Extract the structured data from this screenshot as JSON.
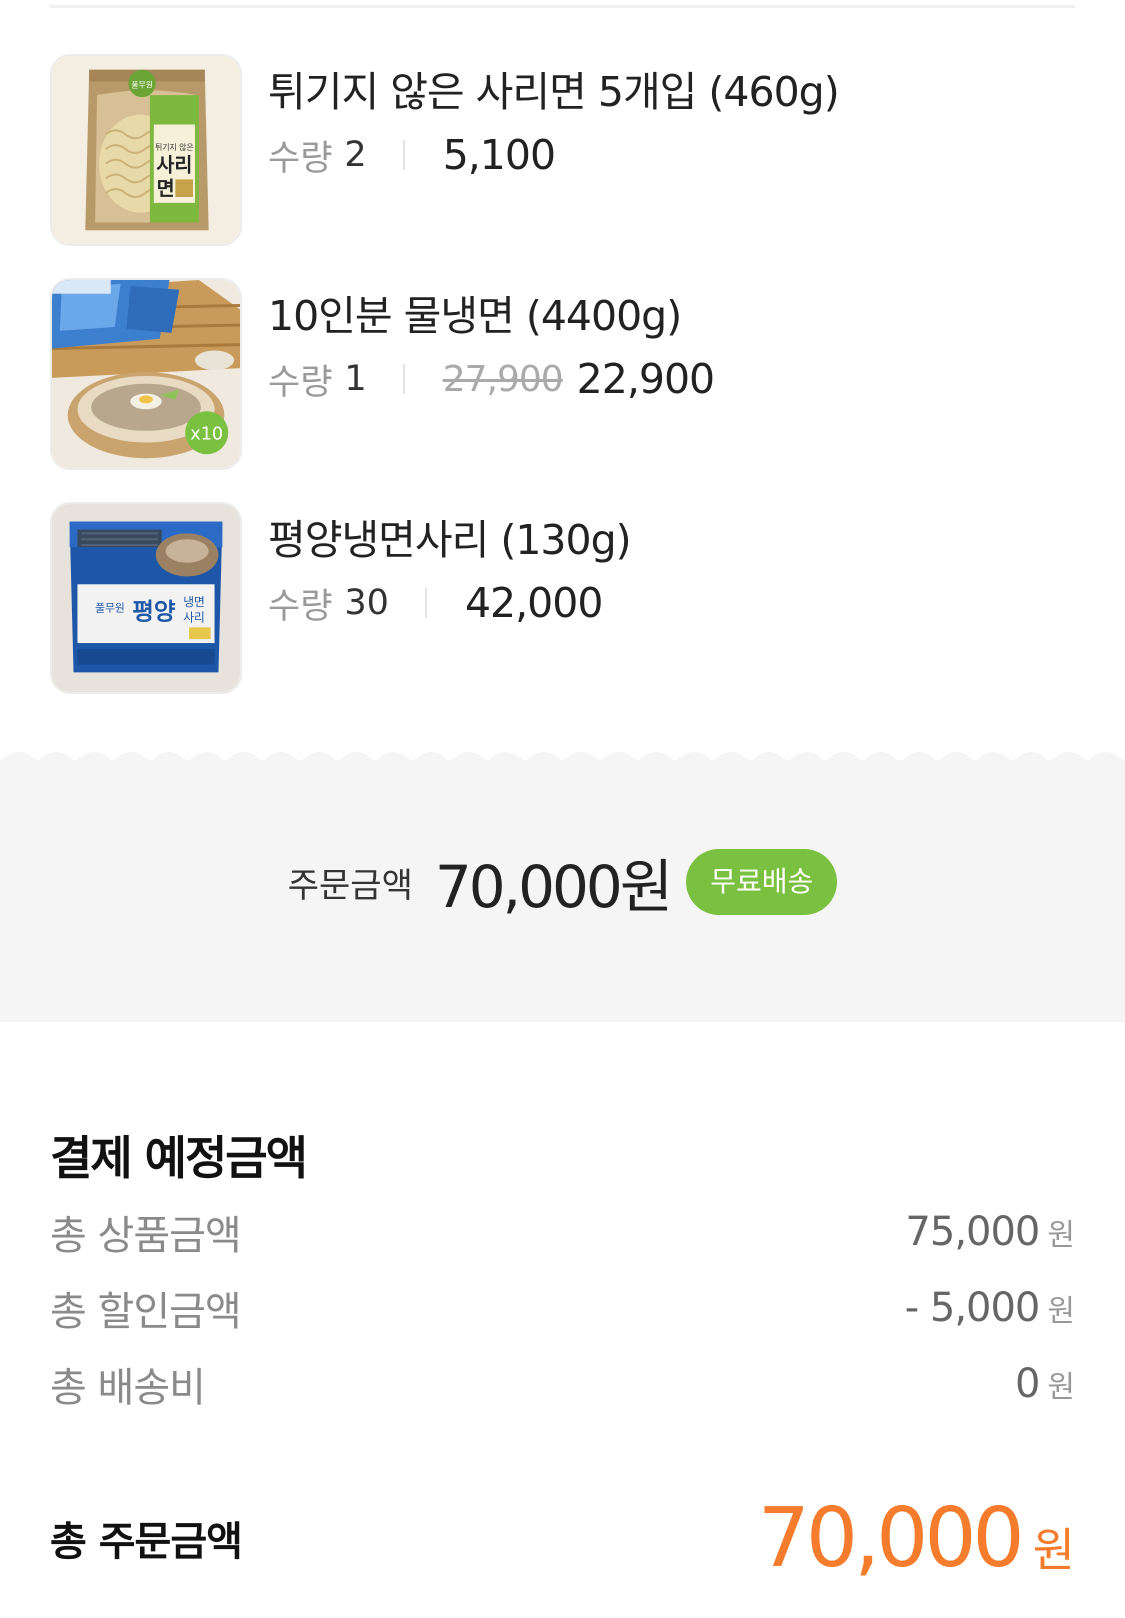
{
  "cart_items": [
    {
      "name": "튀기지 않은 사리면 5개입 (460g)",
      "qty_label": "수량",
      "qty": "2",
      "original_price": "",
      "price": "5,100",
      "package_text": [
        "풀무원",
        "튀기지 않은",
        "사리",
        "면"
      ]
    },
    {
      "name": "10인분 물냉면 (4400g)",
      "qty_label": "수량",
      "qty": "1",
      "original_price": "27,900",
      "price": "22,900",
      "badge": "x10"
    },
    {
      "name": "평양냉면사리 (130g)",
      "qty_label": "수량",
      "qty": "30",
      "original_price": "",
      "price": "42,000",
      "package_text": [
        "풀무원",
        "평양",
        "냉면",
        "사리"
      ]
    }
  ],
  "order_summary": {
    "label": "주문금액",
    "amount": "70,000원",
    "shipping_badge": "무료배송"
  },
  "payment": {
    "title": "결제 예정금액",
    "rows": [
      {
        "label": "총 상품금액",
        "value": "75,000",
        "unit": "원"
      },
      {
        "label": "총 할인금액",
        "value": "- 5,000",
        "unit": "원"
      },
      {
        "label": "총 배송비",
        "value": "0",
        "unit": "원"
      }
    ],
    "total_label": "총 주문금액",
    "total_value": "70,000",
    "total_unit": "원"
  },
  "colors": {
    "accent_orange": "#f47c2c",
    "badge_green": "#7ac142",
    "band_gray": "#f5f5f5"
  }
}
